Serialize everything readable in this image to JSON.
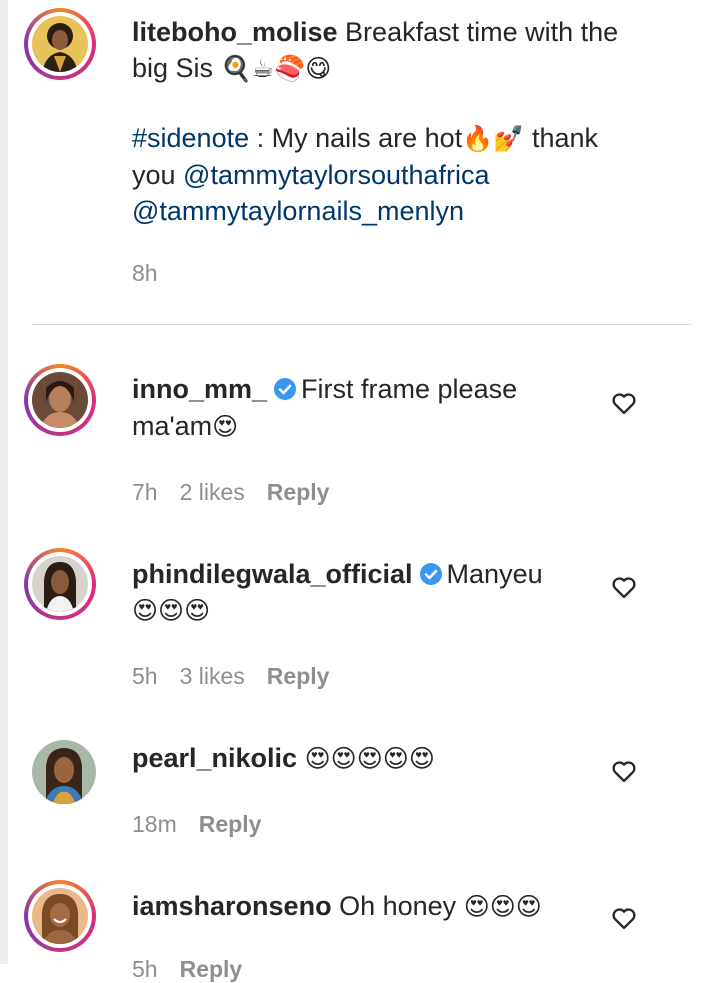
{
  "caption": {
    "username": "liteboho_molise",
    "line1_text": " Breakfast time with the",
    "line2_text": "big Sis ",
    "line2_emoji": "🍳☕🍣😋",
    "hashtag": "#sidenote",
    "line3_text": " : My nails are hot",
    "line3_emoji": "🔥💅",
    "line3_end": " thank",
    "line4_prefix": "you ",
    "mention1": "@tammytaylorsouthafrica",
    "mention2": "@tammytaylornails_menlyn",
    "time": "8h"
  },
  "comments": [
    {
      "username": "inno_mm_",
      "verified": true,
      "text_line1": "First frame please",
      "text_line2": "ma'am",
      "emoji": "😍",
      "time": "7h",
      "likes": "2 likes",
      "reply": "Reply"
    },
    {
      "username": "phindilegwala_official",
      "verified": true,
      "text_line1": "Manyeu",
      "emoji": "😍😍😍",
      "time": "5h",
      "likes": "3 likes",
      "reply": "Reply"
    },
    {
      "username": "pearl_nikolic",
      "verified": false,
      "emoji": "😍😍😍😍😍",
      "time": "18m",
      "reply": "Reply"
    },
    {
      "username": "iamsharonseno",
      "verified": false,
      "text_line1": "Oh honey",
      "emoji": "😍😍😍",
      "time": "5h",
      "reply": "Reply"
    }
  ],
  "colors": {
    "text": "#262626",
    "secondary": "#8e8e8e",
    "link": "#00376b",
    "verified": "#3897f0"
  },
  "icons": {
    "like": "heart-outline-icon",
    "verified": "verified-badge-icon"
  }
}
